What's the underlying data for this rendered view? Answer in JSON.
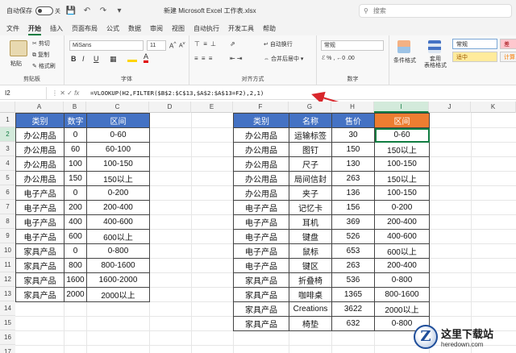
{
  "titlebar": {
    "autosave_label": "自动保存",
    "autosave_state": "关",
    "doc_title": "新建 Microsoft Excel 工作表.xlsx",
    "search_placeholder": "搜索",
    "icons": [
      "save-icon",
      "undo-icon",
      "redo-icon",
      "customize-icon"
    ]
  },
  "menu": {
    "items": [
      "文件",
      "开始",
      "插入",
      "页面布局",
      "公式",
      "数据",
      "审阅",
      "视图",
      "自动执行",
      "开发工具",
      "帮助"
    ],
    "active": "开始"
  },
  "ribbon": {
    "clipboard": {
      "paste": "粘贴",
      "cut": "剪切",
      "copy": "复制",
      "format_painter": "格式刷",
      "label": "剪贴板"
    },
    "font": {
      "name": "MiSans",
      "size": "11",
      "label": "字体",
      "bold": "B",
      "italic": "I",
      "underline": "U"
    },
    "alignment": {
      "wrap": "自动换行",
      "merge": "合并后居中",
      "label": "对齐方式"
    },
    "number": {
      "format": "常规",
      "label": "数字"
    },
    "styles": {
      "conditional": "条件格式",
      "table_format": "套用\n表格格式",
      "normal": "常规",
      "bad": "差",
      "neutral": "适中",
      "calc": "计算"
    }
  },
  "formula_bar": {
    "name_box": "I2",
    "fx": "fx",
    "formula": "=VLOOKUP(H2,FILTER($B$2:$C$13,$A$2:$A$13=F2),2,1)"
  },
  "grid": {
    "columns": [
      "A",
      "B",
      "C",
      "D",
      "E",
      "F",
      "G",
      "H",
      "I",
      "J",
      "K"
    ],
    "selected_column": "I",
    "rows": [
      "1",
      "2",
      "3",
      "4",
      "5",
      "6",
      "7",
      "8",
      "9",
      "10",
      "11",
      "12",
      "13",
      "14",
      "15",
      "16",
      "17"
    ],
    "selected_row": "2"
  },
  "left_table": {
    "headers": [
      "类别",
      "数字",
      "区间"
    ],
    "rows": [
      [
        "办公用品",
        "0",
        "0-60"
      ],
      [
        "办公用品",
        "60",
        "60-100"
      ],
      [
        "办公用品",
        "100",
        "100-150"
      ],
      [
        "办公用品",
        "150",
        "150以上"
      ],
      [
        "电子产品",
        "0",
        "0-200"
      ],
      [
        "电子产品",
        "200",
        "200-400"
      ],
      [
        "电子产品",
        "400",
        "400-600"
      ],
      [
        "电子产品",
        "600",
        "600以上"
      ],
      [
        "家具产品",
        "0",
        "0-800"
      ],
      [
        "家具产品",
        "800",
        "800-1600"
      ],
      [
        "家具产品",
        "1600",
        "1600-2000"
      ],
      [
        "家具产品",
        "2000",
        "2000以上"
      ]
    ]
  },
  "right_table": {
    "headers": [
      "类别",
      "名称",
      "售价",
      "区间"
    ],
    "rows": [
      [
        "办公用品",
        "运输标签",
        "30",
        "0-60"
      ],
      [
        "办公用品",
        "图钉",
        "150",
        "150以上"
      ],
      [
        "办公用品",
        "尺子",
        "130",
        "100-150"
      ],
      [
        "办公用品",
        "局间信封",
        "263",
        "150以上"
      ],
      [
        "办公用品",
        "夹子",
        "136",
        "100-150"
      ],
      [
        "电子产品",
        "记忆卡",
        "156",
        "0-200"
      ],
      [
        "电子产品",
        "耳机",
        "369",
        "200-400"
      ],
      [
        "电子产品",
        "键盘",
        "526",
        "400-600"
      ],
      [
        "电子产品",
        "鼠标",
        "653",
        "600以上"
      ],
      [
        "电子产品",
        "键区",
        "263",
        "200-400"
      ],
      [
        "家具产品",
        "折叠椅",
        "536",
        "0-800"
      ],
      [
        "家具产品",
        "咖啡桌",
        "1365",
        "800-1600"
      ],
      [
        "家具产品",
        "Creations",
        "3622",
        "2000以上"
      ],
      [
        "家具产品",
        "椅垫",
        "632",
        "0-800"
      ]
    ]
  },
  "watermark": {
    "logo_letter": "Z",
    "title": "这里下载站",
    "url": "heredown.com"
  },
  "colors": {
    "header_blue": "#4472c4",
    "header_orange": "#ed7d31",
    "excel_green": "#107c41",
    "arrow_red": "#d9262b"
  }
}
